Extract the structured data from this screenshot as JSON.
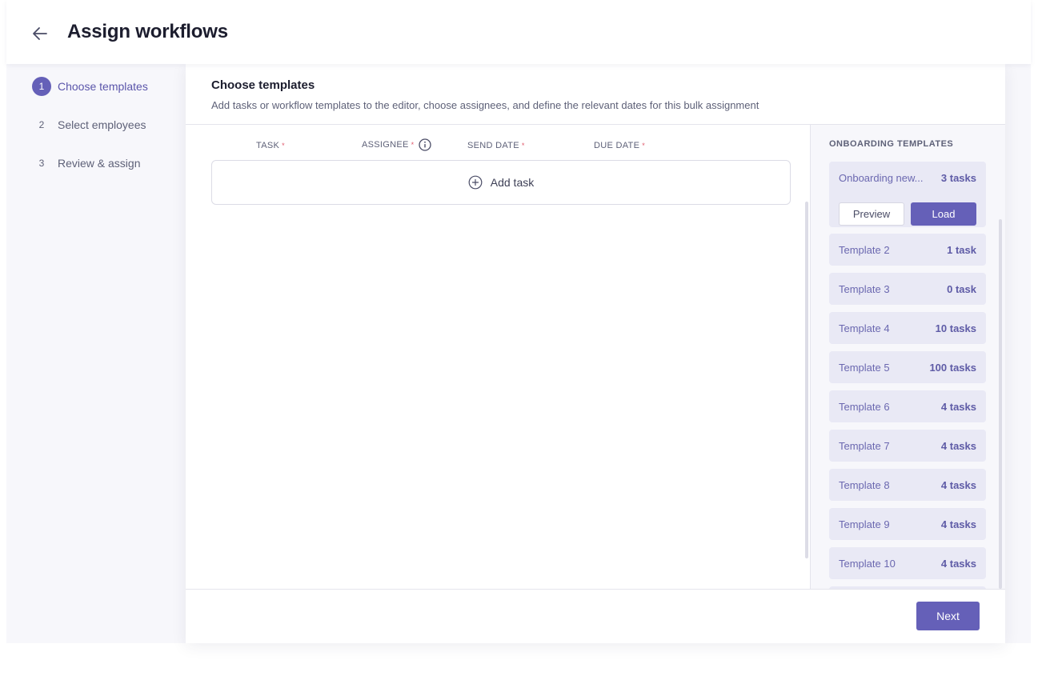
{
  "header": {
    "title": "Assign workflows"
  },
  "stepper": {
    "steps": [
      {
        "number": "1",
        "label": "Choose templates",
        "active": true
      },
      {
        "number": "2",
        "label": "Select employees",
        "active": false
      },
      {
        "number": "3",
        "label": "Review & assign",
        "active": false
      }
    ]
  },
  "main": {
    "title": "Choose templates",
    "subtitle": "Add tasks or workflow templates to the editor, choose assignees, and define the relevant dates for this bulk assignment",
    "columns": {
      "task": "TASK",
      "assignee": "ASSIGNEE",
      "send_date": "SEND DATE",
      "due_date": "DUE DATE",
      "required_mark": "*"
    },
    "add_task_label": "Add task"
  },
  "templates": {
    "heading": "ONBOARDING TEMPLATES",
    "preview_label": "Preview",
    "load_label": "Load",
    "items": [
      {
        "name": "Onboarding new...",
        "count": "3 tasks"
      },
      {
        "name": "Template 2",
        "count": "1 task"
      },
      {
        "name": "Template 3",
        "count": "0 task"
      },
      {
        "name": "Template 4",
        "count": "10 tasks"
      },
      {
        "name": "Template 5",
        "count": "100 tasks"
      },
      {
        "name": "Template 6",
        "count": "4 tasks"
      },
      {
        "name": "Template 7",
        "count": "4 tasks"
      },
      {
        "name": "Template 8",
        "count": "4 tasks"
      },
      {
        "name": "Template 9",
        "count": "4 tasks"
      },
      {
        "name": "Template 10",
        "count": "4 tasks"
      }
    ]
  },
  "footer": {
    "next_label": "Next"
  },
  "colors": {
    "accent": "#6560b8",
    "template_bg": "#e9e9f5",
    "required": "#e05a6c"
  },
  "icons": {
    "back": "arrow-left-icon",
    "info": "info-circle-icon",
    "add": "plus-circle-icon"
  }
}
